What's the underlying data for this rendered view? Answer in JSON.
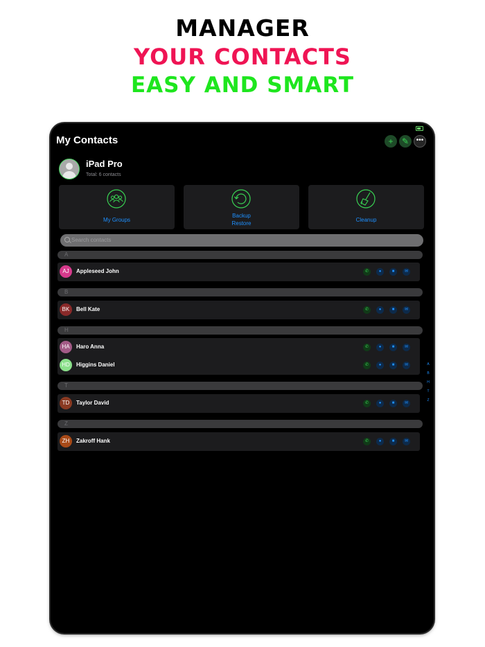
{
  "promo": {
    "line1": "MANAGER",
    "line2": "YOUR CONTACTS",
    "line3": "EASY AND SMART"
  },
  "nav": {
    "title": "My Contacts",
    "add_icon": "plus-icon",
    "edit_icon": "pencil-icon",
    "more_icon": "ellipsis-icon"
  },
  "owner": {
    "name": "iPad Pro",
    "subtitle": "Total: 6 contacts"
  },
  "actions": [
    {
      "label": "My Groups",
      "icon": "groups-icon"
    },
    {
      "label": "Backup",
      "label2": "Restore",
      "icon": "backup-restore-icon"
    },
    {
      "label": "Cleanup",
      "icon": "broom-icon"
    }
  ],
  "search": {
    "placeholder": "Search contacts"
  },
  "sections": [
    {
      "letter": "A",
      "contacts": [
        {
          "initials": "AJ",
          "name": "Appleseed John",
          "color": "#d63a8c"
        }
      ]
    },
    {
      "letter": "B",
      "contacts": [
        {
          "initials": "BK",
          "name": "Bell Kate",
          "color": "#8a2a2a"
        }
      ]
    },
    {
      "letter": "H",
      "contacts": [
        {
          "initials": "HA",
          "name": "Haro Anna",
          "color": "#a25a86"
        },
        {
          "initials": "HD",
          "name": "Higgins Daniel",
          "color": "#8be08b"
        }
      ]
    },
    {
      "letter": "T",
      "contacts": [
        {
          "initials": "TD",
          "name": "Taylor David",
          "color": "#8a3a22"
        }
      ]
    },
    {
      "letter": "Z",
      "contacts": [
        {
          "initials": "ZH",
          "name": "Zakroff Hank",
          "color": "#a84a18"
        }
      ]
    }
  ],
  "index": [
    "A",
    "B",
    "H",
    "T",
    "Z"
  ],
  "colors": {
    "accent_green": "#39d353",
    "accent_blue": "#1e90ff",
    "promo_red": "#ef1454",
    "promo_green": "#1ee61e"
  }
}
